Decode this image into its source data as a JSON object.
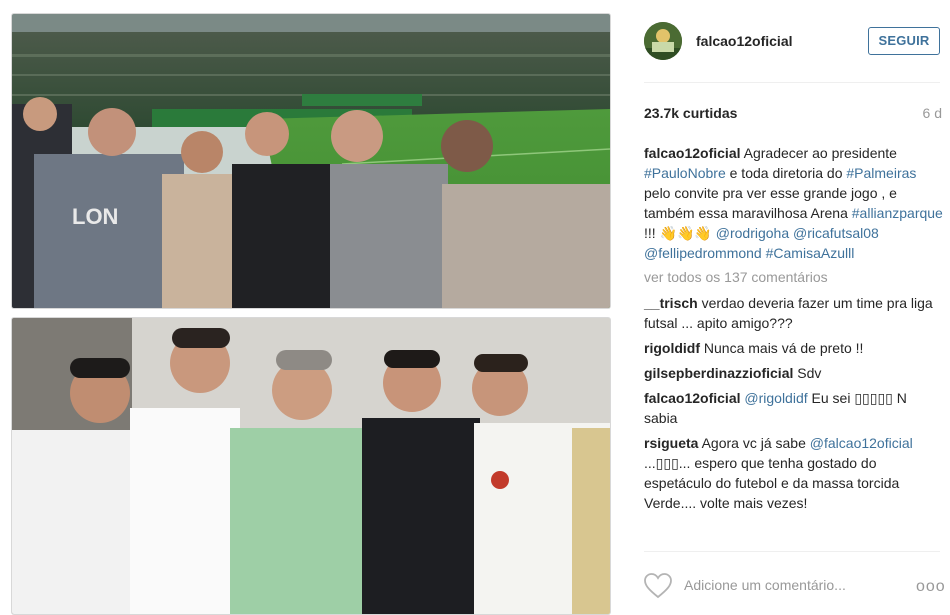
{
  "post": {
    "username": "falcao12oficial",
    "follow_label": "SEGUIR",
    "likes": "23.7k curtidas",
    "time": "6 d"
  },
  "caption": {
    "user": "falcao12oficial",
    "line1": "Agradecer ao presidente",
    "tag_paulo": "#PauloNobre",
    "line2": " e toda diretoria do",
    "tag_palmeiras": "#Palmeiras",
    "line3": " pelo convite pra ver esse grande jogo , e também essa maravilhosa Arena ",
    "tag_allianz": "#allianzparque",
    "line4": " !!! 👋👋👋 ",
    "tag_rodrigo": "@rodrigoha",
    "tag_rica": "@ricafutsal08",
    "tag_fellipe": "@fellipedrommond",
    "tag_camisa": "#CamisaAzulll"
  },
  "view_all": "ver todos os 137 comentários",
  "comments": [
    {
      "user": "__trisch",
      "text": "verdao deveria fazer um time pra liga futsal ... apito amigo???"
    },
    {
      "user": "rigoldidf",
      "text": "Nunca mais vá de preto !!"
    },
    {
      "user": "gilsepberdinazzioficial",
      "text": "Sdv"
    },
    {
      "user": "falcao12oficial",
      "mention": "@rigoldidf",
      "text": "Eu sei ▯▯▯▯▯ N sabia"
    },
    {
      "user": "rsigueta",
      "text": "Agora vc já sabe",
      "mention": "@falcao12oficial",
      "text2": "...▯▯▯... espero que tenha gostado do espetáculo do futebol e da massa torcida Verde.... volte mais vezes!"
    }
  ],
  "add_comment_placeholder": "Adicione um comentário...",
  "more_label": "ooo",
  "icons": {
    "avatar": "avatar",
    "like": "heart-icon",
    "more": "more-options-icon"
  },
  "colors": {
    "link": "#3f729b",
    "muted": "#999999",
    "text": "#262626"
  }
}
